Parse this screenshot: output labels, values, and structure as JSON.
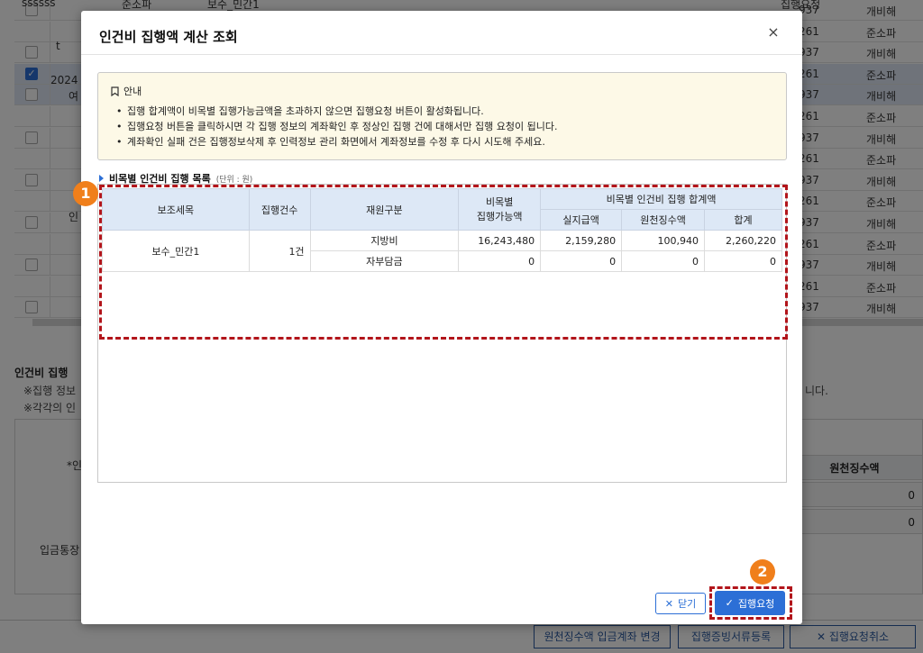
{
  "background": {
    "rows": [
      {
        "num": "937",
        "type": "개비해",
        "checked": false
      },
      {
        "num": "261",
        "type": "준소파"
      },
      {
        "num": "937",
        "type": "개비해"
      },
      {
        "num": "261",
        "type": "준소파"
      },
      {
        "num": "937",
        "type": "개비해"
      },
      {
        "num": "261",
        "type": "준소파"
      },
      {
        "num": "937",
        "type": "개비해"
      },
      {
        "num": "261",
        "type": "준소파"
      },
      {
        "num": "937",
        "type": "개비해"
      },
      {
        "num": "261",
        "type": "준소파"
      },
      {
        "num": "937",
        "type": "개비해"
      },
      {
        "num": "261",
        "type": "준소파"
      },
      {
        "num": "937",
        "type": "개비해"
      },
      {
        "num": "261",
        "type": "준소파"
      },
      {
        "num": "937",
        "type": "개비해"
      }
    ],
    "top_cells": [
      "ssssss",
      "준소파",
      "보수_민간1",
      "집행요청"
    ],
    "left_labels": [
      "t",
      "2024",
      "여",
      "인"
    ],
    "section_title": "인건비 집행",
    "note1": "※집행 정보",
    "note1_tail": "니다.",
    "note2": "※각각의 인",
    "field1": "*인",
    "field2": "입금통장",
    "panel_header": "원천징수액",
    "panel_values": [
      "0",
      "0"
    ],
    "buttons": [
      "원천징수액 입금계좌 변경",
      "집행증빙서류등록",
      "집행요청취소"
    ]
  },
  "modal": {
    "title": "인건비 집행액 계산 조회",
    "close_glyph": "×",
    "notice": {
      "heading": "안내",
      "items": [
        "집행 합계액이 비목별 집행가능금액을 초과하지 않으면 집행요청 버튼이 활성화됩니다.",
        "집행요청 버튼을 클릭하시면 각 집행 정보의 계좌확인 후 정상인 집행 건에 대해서만 집행 요청이 됩니다.",
        "계좌확인 실패 건은 집행정보삭제 후 인력정보 관리 화면에서 계좌정보를 수정 후 다시 시도해 주세요."
      ]
    },
    "list_title": "비목별 인건비 집행 목록",
    "unit": "(단위 : 원)",
    "table": {
      "headers": {
        "sub_item": "보조세목",
        "count": "집행건수",
        "source": "재원구분",
        "available": "비목별\n집행가능액",
        "sum_group": "비목별 인건비 집행 합계액",
        "actual_pay": "실지급액",
        "withholding": "원천징수액",
        "total": "합계"
      },
      "group": {
        "sub_item": "보수_민간1",
        "count": "1건"
      },
      "rows": [
        {
          "source": "지방비",
          "available": "16,243,480",
          "actual_pay": "2,159,280",
          "withholding": "100,940",
          "total": "2,260,220"
        },
        {
          "source": "자부담금",
          "available": "0",
          "actual_pay": "0",
          "withholding": "0",
          "total": "0"
        }
      ]
    },
    "buttons": {
      "close": "닫기",
      "execute": "집행요청"
    },
    "callouts": [
      "1",
      "2"
    ]
  },
  "colors": {
    "accent": "#2c6fd6",
    "callout": "#b2151b",
    "badge": "#f07f1b",
    "notice_bg": "#fdf9e7"
  }
}
